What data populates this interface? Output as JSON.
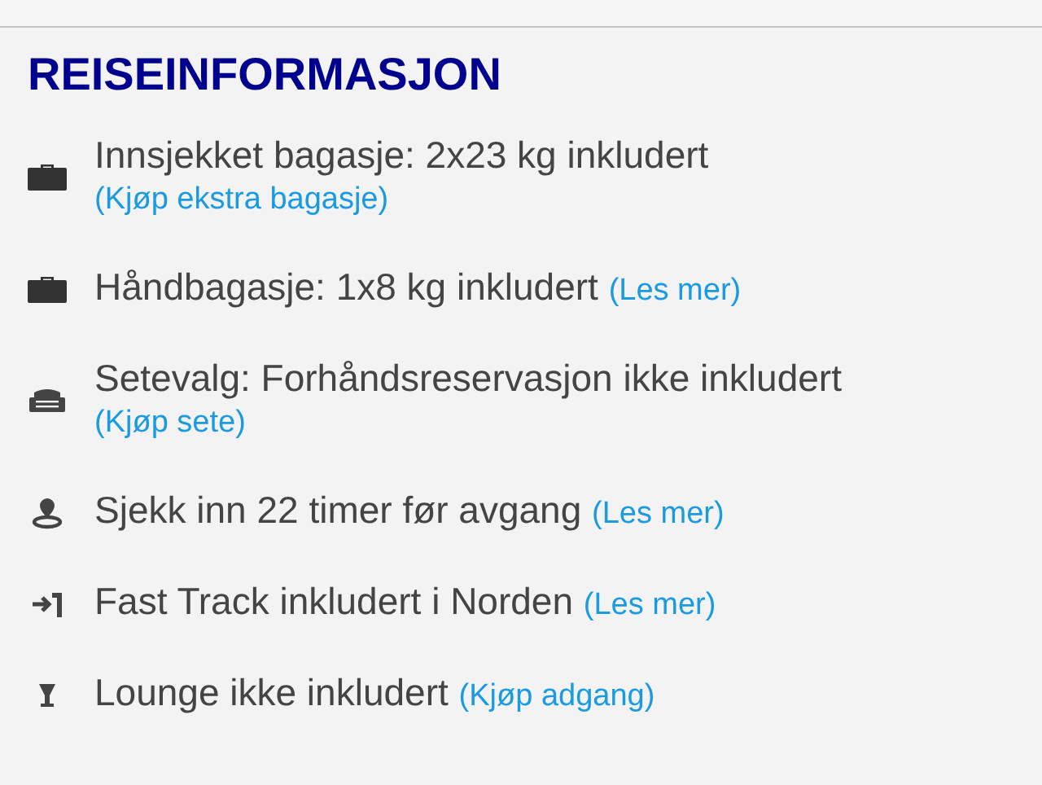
{
  "heading": "REISEINFORMASJON",
  "items": [
    {
      "kind": "suitcase",
      "text": "Innsjekket bagasje: 2x23 kg inkludert",
      "link": "(Kjøp ekstra bagasje)"
    },
    {
      "kind": "suitcase",
      "text": "Håndbagasje: 1x8 kg inkludert",
      "link": "(Les mer)"
    },
    {
      "kind": "seat",
      "text": "Setevalg: Forhåndsreservasjon ikke inkludert",
      "link": "(Kjøp sete)"
    },
    {
      "kind": "pin",
      "text": "Sjekk inn 22 timer før avgang",
      "link": "(Les mer)"
    },
    {
      "kind": "enter",
      "text": "Fast Track inkludert i Norden",
      "link": "(Les mer)"
    },
    {
      "kind": "glass",
      "text": "Lounge ikke inkludert",
      "link": "(Kjøp adgang)"
    }
  ]
}
